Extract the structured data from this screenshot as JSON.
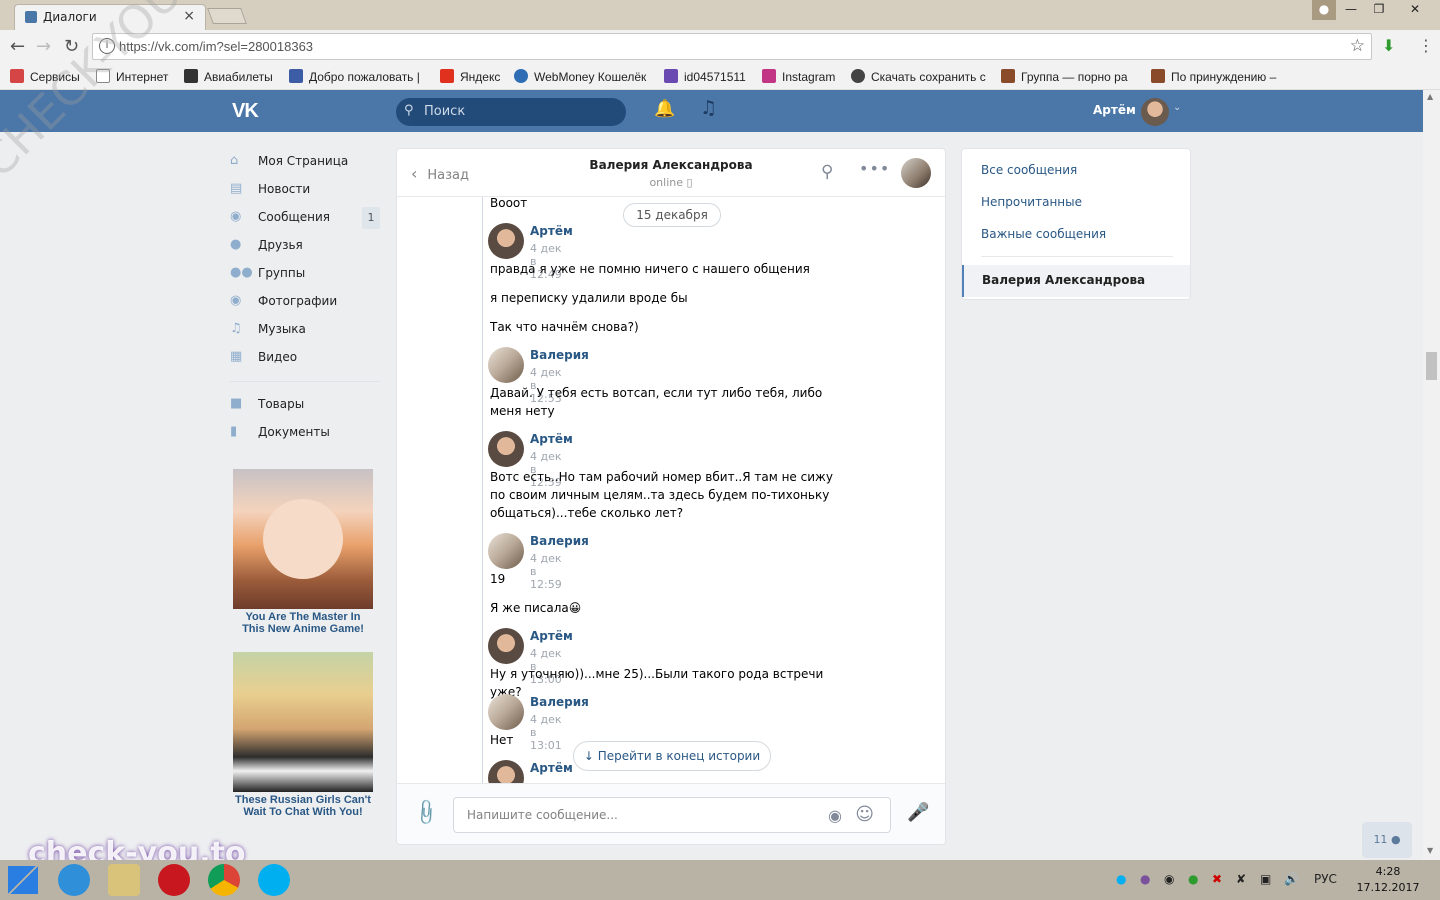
{
  "browser": {
    "tab_title": "Диалоги",
    "url": "https://vk.com/im?sel=280018363",
    "bookmarks": [
      {
        "label": "Сервисы",
        "color": "#d64545"
      },
      {
        "label": "Интернет",
        "color": "#cccccc"
      },
      {
        "label": "Авиабилеты",
        "color": "#333333"
      },
      {
        "label": "Добро пожаловать |",
        "color": "#3c5ca6"
      },
      {
        "label": "Яндекс",
        "color": "#e0301e"
      },
      {
        "label": "WebMoney Кошелёк",
        "color": "#2f6db5"
      },
      {
        "label": "id04571511",
        "color": "#6a4ab0"
      },
      {
        "label": "Instagram",
        "color": "#c13584"
      },
      {
        "label": "Скачать сохранить с",
        "color": "#444444"
      },
      {
        "label": "Группа — порно ра",
        "color": "#8a4b2a"
      },
      {
        "label": "По принуждению –",
        "color": "#8a4b2a"
      }
    ]
  },
  "header": {
    "logo": "VK",
    "search_placeholder": "Поиск",
    "user_name": "Артём"
  },
  "left_menu": {
    "items": [
      {
        "label": "Моя Страница",
        "icon": "home-icon"
      },
      {
        "label": "Новости",
        "icon": "news-icon"
      },
      {
        "label": "Сообщения",
        "icon": "messages-icon"
      },
      {
        "label": "Друзья",
        "icon": "friends-icon"
      },
      {
        "label": "Группы",
        "icon": "groups-icon"
      },
      {
        "label": "Фотографии",
        "icon": "photos-icon"
      },
      {
        "label": "Музыка",
        "icon": "music-icon"
      },
      {
        "label": "Видео",
        "icon": "video-icon"
      },
      {
        "label": "Товары",
        "icon": "market-icon"
      },
      {
        "label": "Документы",
        "icon": "docs-icon"
      }
    ],
    "messages_badge": "1"
  },
  "ads": [
    {
      "caption": "You Are The Master In This New Anime Game!"
    },
    {
      "caption": "These Russian Girls Can't Wait To Chat With You!"
    }
  ],
  "chat": {
    "back_label": "Назад",
    "peer_name": "Валерия Александрова",
    "peer_status": "online",
    "date_separator": "15 декабря",
    "first_text": "Вооот",
    "messages": [
      {
        "author": "Артём",
        "time": "4 дек в 12:49",
        "lines": [
          "правда я уже не помню ничего с нашего общения",
          "я переписку удалили вроде бы",
          "Так что начнём снова?)"
        ]
      },
      {
        "author": "Валерия",
        "time": "4 дек в 12:53",
        "lines": [
          "Давай. У тебя есть вотсап, если тут либо тебя, либо меня нету"
        ]
      },
      {
        "author": "Артём",
        "time": "4 дек в 12:59",
        "lines": [
          "Вотс есть..Но там рабочий номер вбит..Я там не сижу по своим личным целям..та здесь будем по-тихоньку общаться)...тебе сколько лет?"
        ]
      },
      {
        "author": "Валерия",
        "time": "4 дек в 12:59",
        "lines": [
          "19",
          "Я же писала😀"
        ]
      },
      {
        "author": "Артём",
        "time": "4 дек в 13:00",
        "lines": [
          "Ну я уточняю))...мне 25)...Были такого рода встречи уже?"
        ]
      },
      {
        "author": "Валерия",
        "time": "4 дек в 13:01",
        "lines": [
          "Нет"
        ]
      },
      {
        "author": "Артём",
        "time": "",
        "lines": []
      }
    ],
    "scroll_to_end": "Перейти в конец истории",
    "composer_placeholder": "Напишите сообщение..."
  },
  "right_panel": {
    "items": [
      "Все сообщения",
      "Непрочитанные",
      "Важные сообщения"
    ],
    "active_dialog": "Валерия Александрова"
  },
  "online_widget": "11",
  "watermarks": {
    "big": "CHECK-YOU.ME",
    "site": "check-you.to"
  },
  "taskbar": {
    "lang": "РУС",
    "time": "4:28",
    "date": "17.12.2017"
  }
}
